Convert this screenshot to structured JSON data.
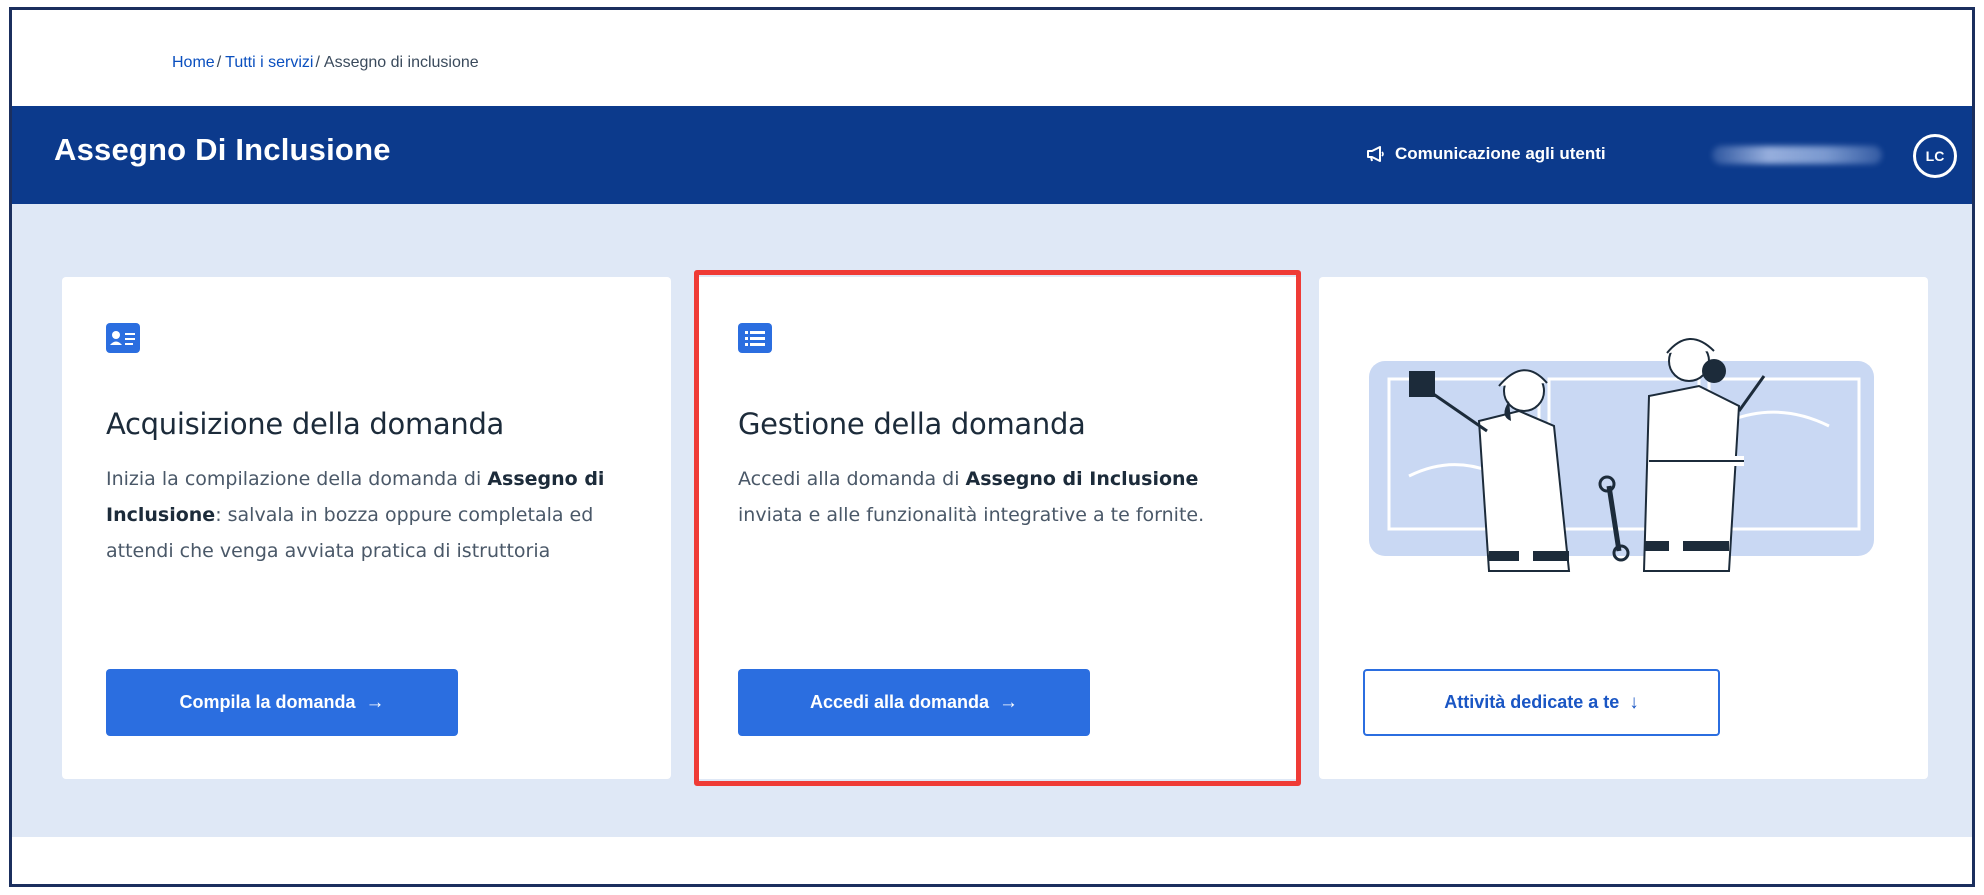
{
  "breadcrumb": {
    "items": [
      {
        "label": "Home",
        "link": true
      },
      {
        "label": "Tutti i servizi",
        "link": true
      },
      {
        "label": "Assegno di inclusione",
        "link": false
      }
    ],
    "separator": "/"
  },
  "header": {
    "title": "Assegno Di Inclusione",
    "communication_label": "Comunicazione agli utenti",
    "user_initials": "LC",
    "background_color": "#0c3a8c"
  },
  "cards": [
    {
      "icon": "id-card-icon",
      "title": "Acquisizione della domanda",
      "text_before": "Inizia la compilazione della domanda di ",
      "text_bold": "Assegno di Inclusione",
      "text_after": ": salvala in bozza oppure completala ed attendi che venga avviata pratica di istruttoria",
      "button_label": "Compila la domanda",
      "button_icon": "arrow-right-icon"
    },
    {
      "icon": "list-icon",
      "title": "Gestione della domanda",
      "text_before": "Accedi alla domanda di ",
      "text_bold": "Assegno di Inclusione",
      "text_after": " inviata e alle funzionalità integrative a te fornite.",
      "button_label": "Accedi alla domanda",
      "button_icon": "arrow-right-icon",
      "highlighted": true
    },
    {
      "illustration": "workers-illustration",
      "button_label": "Attività dedicate a te",
      "button_icon": "arrow-down-icon"
    }
  ],
  "colors": {
    "primary": "#2b6ee0",
    "band": "#dfe8f6",
    "highlight": "#ef3b36"
  }
}
